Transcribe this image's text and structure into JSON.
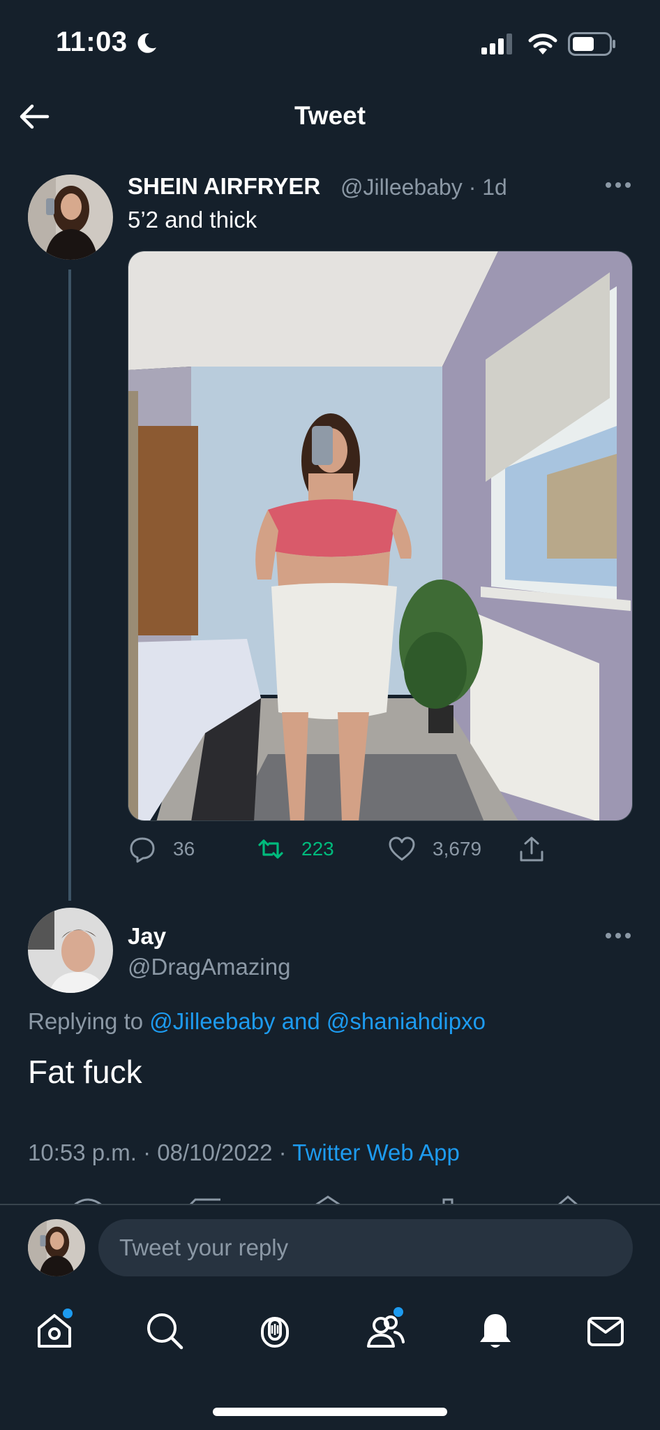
{
  "status_bar": {
    "time": "11:03"
  },
  "header": {
    "title": "Tweet"
  },
  "tweet": {
    "name": "SHEIN AIRFRYER",
    "handle": "@Jilleebaby",
    "time": "· 1d",
    "text": "5’2 and thick",
    "replies": "36",
    "retweets": "223",
    "likes": "3,679"
  },
  "reply": {
    "name": "Jay",
    "handle": "@DragAmazing",
    "replying_prefix": "Replying to",
    "replying_users": "@Jilleebaby and @shaniahdipxo",
    "text": "Fat fuck",
    "timestamp": "10:53 p.m. · 08/10/2022 ·",
    "source": "Twitter Web App"
  },
  "composer": {
    "placeholder": "Tweet your reply"
  },
  "colors": {
    "background": "#15202b",
    "accent": "#1d9bf0",
    "retweet": "#00ba7c",
    "muted": "#8b98a5"
  },
  "nav": [
    "home-icon",
    "search-icon",
    "spaces-icon",
    "communities-icon",
    "notifications-icon",
    "messages-icon"
  ]
}
